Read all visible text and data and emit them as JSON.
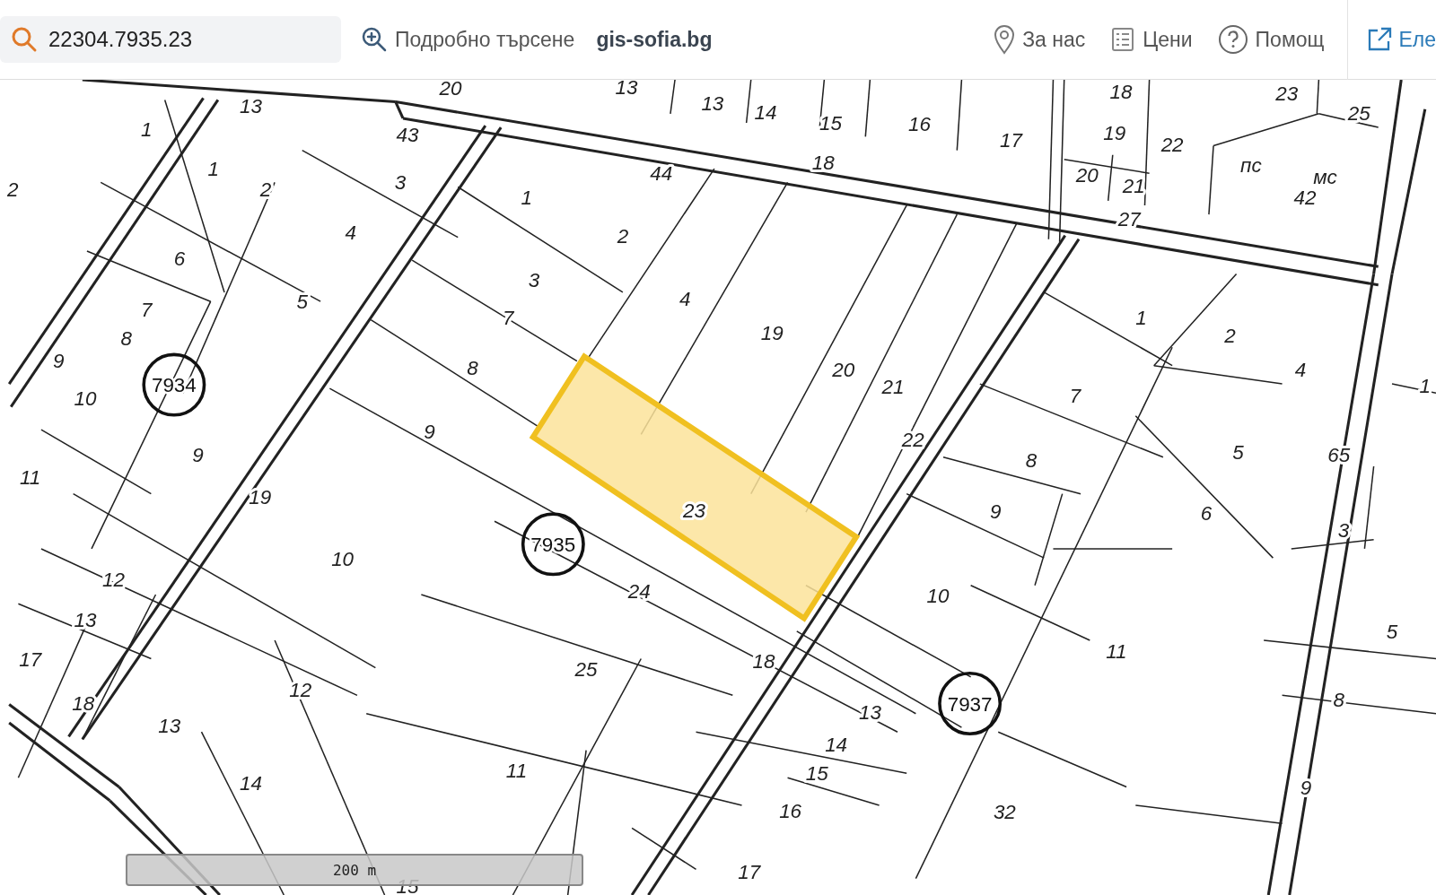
{
  "search": {
    "value": "22304.7935.23"
  },
  "nav": [
    {
      "kind": "search-plus",
      "label": "Подробно търсене"
    },
    {
      "kind": "brand",
      "label": "gis-sofia.bg"
    },
    {
      "kind": "pin",
      "label": "За нас"
    },
    {
      "kind": "list",
      "label": "Цени"
    },
    {
      "kind": "help",
      "label": "Помощ"
    },
    {
      "kind": "external",
      "label": "Еле"
    }
  ],
  "map": {
    "parcel_labels": [
      "20",
      "13",
      "13",
      "14",
      "15",
      "16",
      "17",
      "18",
      "19",
      "22",
      "20",
      "21",
      "23",
      "25",
      "пс",
      "мс",
      "42",
      "27",
      "18",
      "13",
      "43",
      "1",
      "1",
      "2",
      "3",
      "2",
      "4",
      "6",
      "5",
      "7",
      "8",
      "9",
      "10",
      "9",
      "11",
      "19",
      "10",
      "12",
      "13",
      "17",
      "18",
      "12",
      "13",
      "14",
      "15",
      "1",
      "44",
      "2",
      "3",
      "7",
      "4",
      "19",
      "8",
      "9",
      "20",
      "21",
      "22",
      "24",
      "25",
      "11",
      "18",
      "13",
      "14",
      "15",
      "16",
      "17",
      "1",
      "2",
      "4",
      "7",
      "8",
      "5",
      "65",
      "9",
      "6",
      "3",
      "10",
      "11",
      "5",
      "8",
      "32",
      "9",
      "1"
    ],
    "highlighted_parcel": {
      "label": "23"
    },
    "blocks": [
      "7934",
      "7935",
      "7937"
    ],
    "scale": {
      "label": "200 m"
    }
  }
}
